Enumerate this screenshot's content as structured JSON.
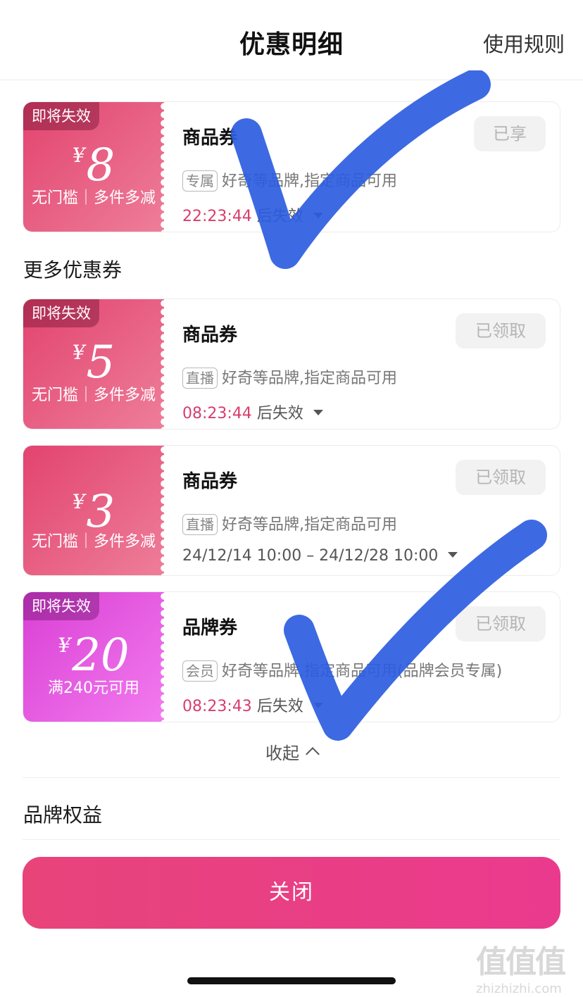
{
  "header": {
    "title": "优惠明细",
    "rules_link": "使用规则"
  },
  "coupons_top": [
    {
      "expire_tag": "即将失效",
      "currency": "¥",
      "amount": "8",
      "condition": "无门槛｜多件多减",
      "name": "商品券",
      "button": "已享",
      "tag": "专属",
      "desc": "好奇等品牌,指定商品可用",
      "countdown": "22:23:44",
      "time_suffix": "后失效"
    }
  ],
  "more_section": {
    "title": "更多优惠券"
  },
  "coupons_more": [
    {
      "expire_tag": "即将失效",
      "currency": "¥",
      "amount": "5",
      "condition": "无门槛｜多件多减",
      "name": "商品券",
      "button": "已领取",
      "tag": "直播",
      "desc": "好奇等品牌,指定商品可用",
      "countdown": "08:23:44",
      "time_suffix": "后失效"
    },
    {
      "currency": "¥",
      "amount": "3",
      "condition": "无门槛｜多件多减",
      "name": "商品券",
      "button": "已领取",
      "tag": "直播",
      "desc": "好奇等品牌,指定商品可用",
      "validity": "24/12/14 10:00 – 24/12/28 10:00"
    },
    {
      "expire_tag": "即将失效",
      "currency": "¥",
      "amount": "20",
      "condition": "满240元可用",
      "name": "品牌券",
      "button": "已领取",
      "tag": "会员",
      "desc": "好奇等品牌,指定商品可用(品牌会员专属)",
      "countdown": "08:23:43",
      "time_suffix": "后失效"
    }
  ],
  "collapse_label": "收起",
  "brand_section": {
    "title": "品牌权益"
  },
  "close_button": "关闭",
  "watermark": {
    "logo": "值值值",
    "url": "zhizhizhi.com"
  },
  "colors": {
    "accent": "#e8447a",
    "countdown": "#d83d6d",
    "stub_red": "#e2436f",
    "stub_pink": "#d93fd4",
    "checkmark": "#2d5de0"
  },
  "icons": [
    "dropdown-caret-icon",
    "chevron-up-icon",
    "checkmark-annotation-icon"
  ]
}
